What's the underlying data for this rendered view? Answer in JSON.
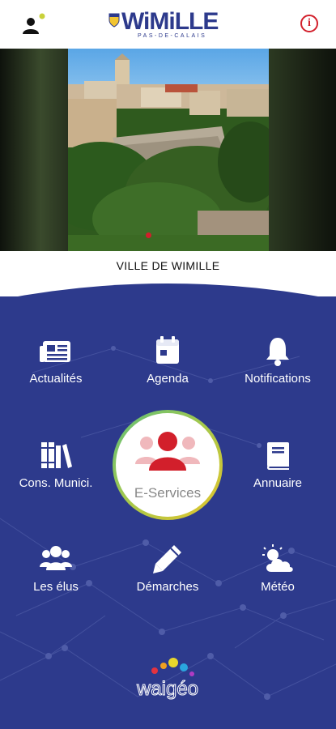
{
  "app": {
    "logo_text": "WiMiLLE",
    "logo_subtitle": "PAS-DE-CALAIS",
    "caption": "VILLE DE WIMILLE"
  },
  "icons": {
    "user": "user-icon",
    "info": "info-icon"
  },
  "menu": {
    "row1": [
      {
        "label": "Actualités",
        "icon": "newspaper-icon"
      },
      {
        "label": "Agenda",
        "icon": "calendar-icon"
      },
      {
        "label": "Notifications",
        "icon": "bell-icon"
      }
    ],
    "row2": [
      {
        "label": "Cons. Munici.",
        "icon": "books-icon"
      },
      {
        "label": "E-Services",
        "icon": "group-users-icon"
      },
      {
        "label": "Annuaire",
        "icon": "book-icon"
      }
    ],
    "row3": [
      {
        "label": "Les élus",
        "icon": "users-icon"
      },
      {
        "label": "Démarches",
        "icon": "pencil-icon"
      },
      {
        "label": "Météo",
        "icon": "weather-icon"
      }
    ]
  },
  "brand": {
    "name": "waigéo"
  },
  "colors": {
    "panel": "#2d3a8c",
    "accent_red": "#d21f2b",
    "logo_blue": "#2d3a8c"
  }
}
